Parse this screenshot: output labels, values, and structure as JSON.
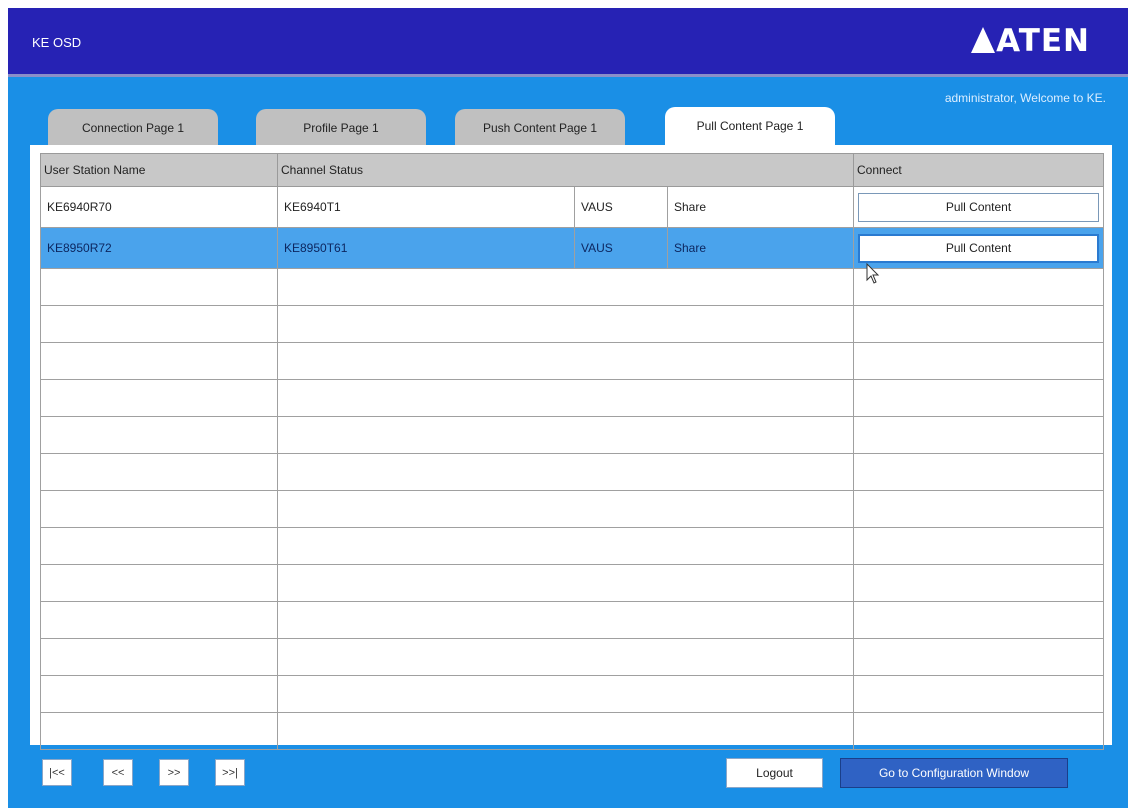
{
  "window": {
    "title": "KE OSD",
    "brand": "ATEN"
  },
  "welcome": "administrator, Welcome to KE.",
  "tabs": [
    {
      "label": "Connection Page 1",
      "active": false
    },
    {
      "label": "Profile Page 1",
      "active": false
    },
    {
      "label": "Push Content Page 1",
      "active": false
    },
    {
      "label": "Pull Content Page 1",
      "active": true
    }
  ],
  "table": {
    "headers": {
      "user_station": "User Station Name",
      "channel_status": "Channel Status",
      "connect": "Connect"
    },
    "rows": [
      {
        "station": "KE6940R70",
        "channel": "KE6940T1",
        "mode": "VAUS",
        "access": "Share",
        "button": "Pull Content",
        "selected": false
      },
      {
        "station": "KE8950R72",
        "channel": "KE8950T61",
        "mode": "VAUS",
        "access": "Share",
        "button": "Pull Content",
        "selected": true
      }
    ],
    "empty_rows": 13
  },
  "footer": {
    "first_label": "|<<",
    "prev_label": "<<",
    "next_label": ">>",
    "last_label": ">>|",
    "logout_label": "Logout",
    "config_label": "Go to Configuration Window"
  },
  "colors": {
    "titlebar": "#2622b4",
    "background": "#1a8fe6",
    "selected_row": "#4aa3ec",
    "config_button": "#2f62c4"
  }
}
